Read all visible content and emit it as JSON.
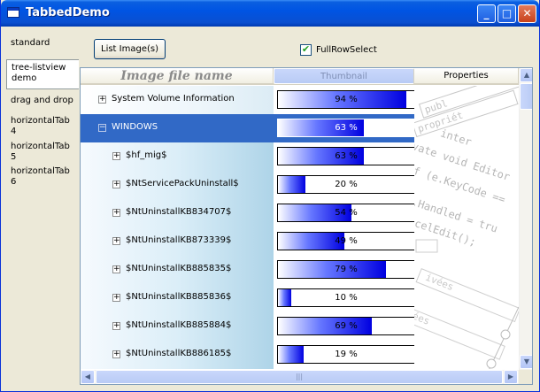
{
  "window": {
    "title": "TabbedDemo",
    "minimize": "_",
    "maximize": "□",
    "close": "✕"
  },
  "tabs": [
    {
      "label": "standard",
      "active": false
    },
    {
      "label": "tree-listview demo",
      "active": true
    },
    {
      "label": "drag and drop",
      "active": false
    },
    {
      "label": "horizontalTab 4",
      "active": false
    },
    {
      "label": "horizontalTab 5",
      "active": false
    },
    {
      "label": "horizontalTab 6",
      "active": false
    }
  ],
  "toolbar": {
    "list_images_label": "List Image(s)",
    "full_row_select": {
      "label": "FullRowSelect",
      "checked": true,
      "check_glyph": "✔"
    }
  },
  "columns": {
    "name": "Image file name",
    "thumbnail": "Thumbnail",
    "properties": "Properties"
  },
  "rows": [
    {
      "name": "System Volume Information",
      "expander": "+",
      "level": 0,
      "percent": 94,
      "percent_text": "94 %",
      "selected": false
    },
    {
      "name": "WINDOWS",
      "expander": "−",
      "level": 0,
      "percent": 63,
      "percent_text": "63 %",
      "selected": true
    },
    {
      "name": "$hf_mig$",
      "expander": "+",
      "level": 1,
      "percent": 63,
      "percent_text": "63 %",
      "selected": false
    },
    {
      "name": "$NtServicePackUninstall$",
      "expander": "+",
      "level": 1,
      "percent": 20,
      "percent_text": "20 %",
      "selected": false
    },
    {
      "name": "$NtUninstallKB834707$",
      "expander": "+",
      "level": 1,
      "percent": 54,
      "percent_text": "54 %",
      "selected": false
    },
    {
      "name": "$NtUninstallKB873339$",
      "expander": "+",
      "level": 1,
      "percent": 49,
      "percent_text": "49 %",
      "selected": false
    },
    {
      "name": "$NtUninstallKB885835$",
      "expander": "+",
      "level": 1,
      "percent": 79,
      "percent_text": "79 %",
      "selected": false
    },
    {
      "name": "$NtUninstallKB885836$",
      "expander": "+",
      "level": 1,
      "percent": 10,
      "percent_text": "10 %",
      "selected": false
    },
    {
      "name": "$NtUninstallKB885884$",
      "expander": "+",
      "level": 1,
      "percent": 69,
      "percent_text": "69 %",
      "selected": false
    },
    {
      "name": "$NtUninstallKB886185$",
      "expander": "+",
      "level": 1,
      "percent": 19,
      "percent_text": "19 %",
      "selected": false
    }
  ],
  "scroll": {
    "up": "▲",
    "down": "▼",
    "left": "◀",
    "right": "▶",
    "grip": "|||"
  }
}
